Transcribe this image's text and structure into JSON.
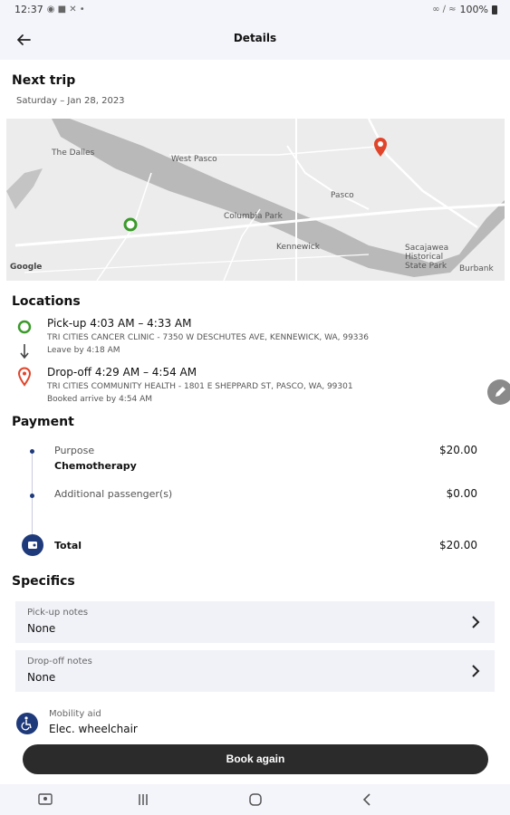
{
  "status_bar": {
    "time": "12:37",
    "battery": "100%"
  },
  "header": {
    "title": "Details"
  },
  "trip": {
    "heading": "Next trip",
    "date": "Saturday – Jan 28, 2023"
  },
  "map": {
    "labels": [
      "The Dalles",
      "West Pasco",
      "Pasco",
      "Columbia Park",
      "Kennewick",
      "Sacajawea Historical State Park",
      "Burbank"
    ],
    "watermark": "Google"
  },
  "locations": {
    "heading": "Locations",
    "pickup": {
      "title": "Pick-up 4:03 AM – 4:33 AM",
      "address": "TRI CITIES CANCER CLINIC - 7350 W DESCHUTES AVE, KENNEWICK, WA, 99336",
      "note": "Leave by 4:18 AM"
    },
    "dropoff": {
      "title": "Drop-off 4:29 AM – 4:54 AM",
      "address": "TRI CITIES COMMUNITY HEALTH - 1801 E SHEPPARD ST, PASCO, WA, 99301",
      "note": "Booked arrive by 4:54 AM"
    }
  },
  "payment": {
    "heading": "Payment",
    "purpose_label": "Purpose",
    "purpose_value": "Chemotherapy",
    "purpose_amount": "$20.00",
    "passengers_label": "Additional passenger(s)",
    "passengers_amount": "$0.00",
    "total_label": "Total",
    "total_amount": "$20.00"
  },
  "specifics": {
    "heading": "Specifics",
    "pickup_notes_label": "Pick-up notes",
    "pickup_notes_value": "None",
    "dropoff_notes_label": "Drop-off notes",
    "dropoff_notes_value": "None",
    "mobility_label": "Mobility aid",
    "mobility_value": "Elec. wheelchair"
  },
  "actions": {
    "book_again": "Book again"
  },
  "colors": {
    "pickup_green": "#3a9a2a",
    "dropoff_red": "#e0452b",
    "accent_navy": "#1f3a7a",
    "button_dark": "#2b2b2b"
  }
}
